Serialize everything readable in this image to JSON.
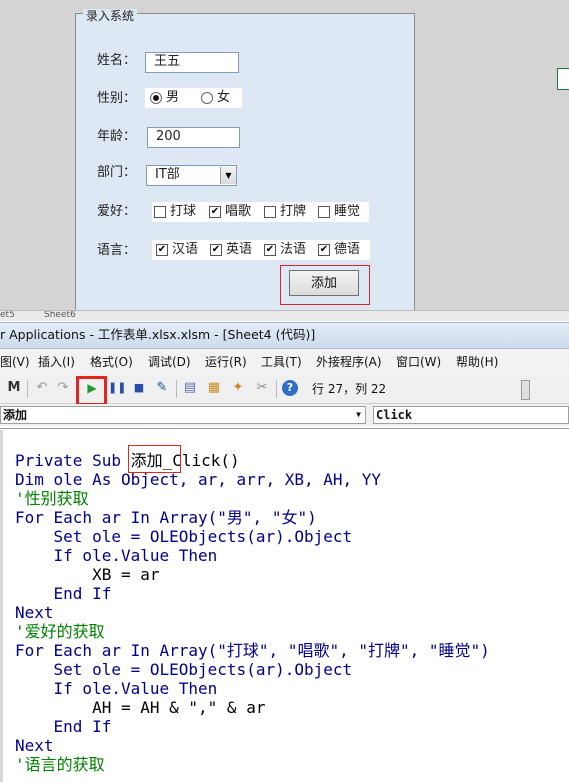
{
  "form": {
    "legend": "录入系统",
    "name_label": "姓名：",
    "name_value": "王五",
    "gender_label": "性别：",
    "gender_options": [
      {
        "label": "男",
        "selected": true
      },
      {
        "label": "女",
        "selected": false
      }
    ],
    "age_label": "年龄：",
    "age_value": "200",
    "dept_label": "部门：",
    "dept_value": "IT部",
    "hobby_label": "爱好：",
    "hobbies": [
      {
        "label": "打球",
        "checked": false
      },
      {
        "label": "唱歌",
        "checked": true
      },
      {
        "label": "打牌",
        "checked": false
      },
      {
        "label": "睡觉",
        "checked": false
      }
    ],
    "lang_label": "语言：",
    "languages": [
      {
        "label": "汉语",
        "checked": true
      },
      {
        "label": "英语",
        "checked": true
      },
      {
        "label": "法语",
        "checked": true
      },
      {
        "label": "德语",
        "checked": true
      }
    ],
    "add_button": "添加"
  },
  "sheet_tabs": [
    "et5",
    "Sheet6"
  ],
  "vba": {
    "title": "r Applications - 工作表单.xlsx.xlsm - [Sheet4 (代码)]",
    "menu": [
      "图(V)",
      "插入(I)",
      "格式(O)",
      "调试(D)",
      "运行(R)",
      "工具(T)",
      "外接程序(A)",
      "窗口(W)",
      "帮助(H)"
    ],
    "cursor_position": "行 27，列 22",
    "object_combo": "添加",
    "proc_combo": "Click",
    "code": {
      "l1_kw": "Private Sub ",
      "l1_name": "添加",
      "l1_rest": "_Click()",
      "l2": "Dim ole As Object, ar, arr, XB, AH, YY",
      "l3": "'性别获取",
      "l4": "For Each ar In Array(\"男\", \"女\")",
      "l5": "    Set ole = OLEObjects(ar).Object",
      "l6": "    If ole.Value Then",
      "l7": "        XB = ar",
      "l8": "    End If",
      "l9": "Next",
      "l10": "'爱好的获取",
      "l11": "For Each ar In Array(\"打球\", \"唱歌\", \"打牌\", \"睡觉\")",
      "l12": "    Set ole = OLEObjects(ar).Object",
      "l13": "    If ole.Value Then",
      "l14": "        AH = AH & \",\" & ar",
      "l15": "    End If",
      "l16": "Next",
      "l17": "'语言的获取"
    }
  },
  "colors": {
    "form_bg": "#dde8f4",
    "highlight": "#e0261f",
    "keyword": "#00008b",
    "comment": "#008000"
  }
}
